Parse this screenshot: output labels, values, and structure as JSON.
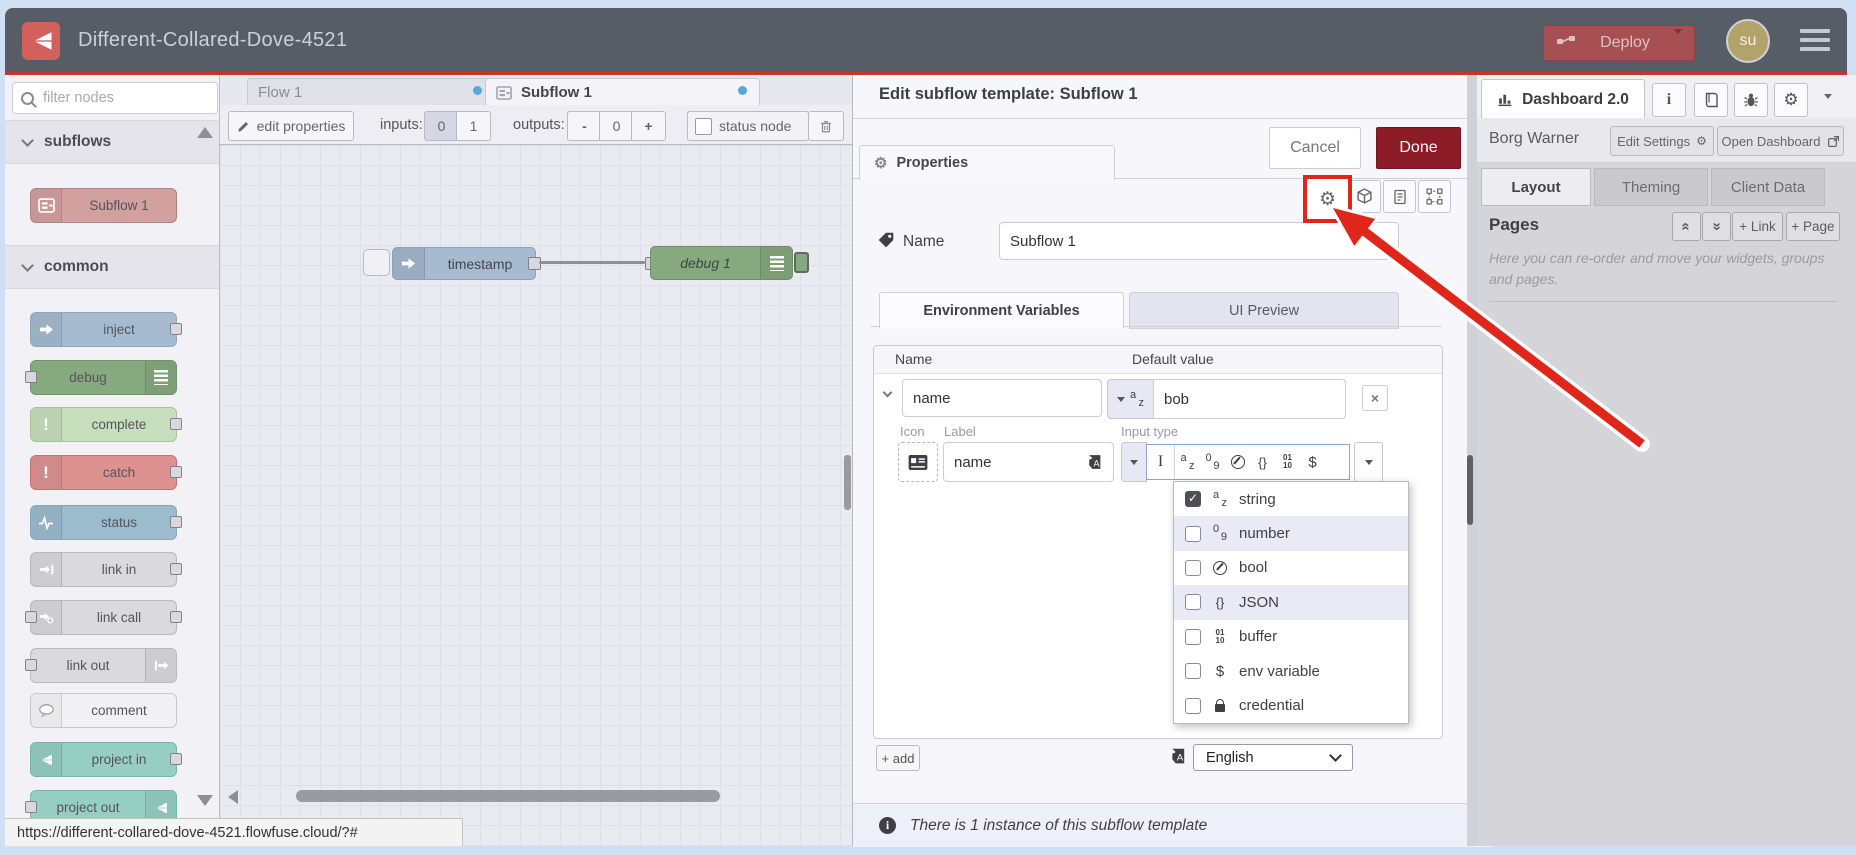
{
  "app": {
    "title": "Different-Collared-Dove-4521",
    "deploy_label": "Deploy",
    "avatar": "su",
    "url_tooltip": "https://different-collared-dove-4521.flowfuse.cloud/?#"
  },
  "palette": {
    "filter_placeholder": "filter nodes",
    "category_subflows": "subflows",
    "category_common": "common",
    "subflow_node": "Subflow 1",
    "common_nodes": [
      {
        "label": "inject"
      },
      {
        "label": "debug"
      },
      {
        "label": "complete"
      },
      {
        "label": "catch"
      },
      {
        "label": "status"
      },
      {
        "label": "link in"
      },
      {
        "label": "link call"
      },
      {
        "label": "link out"
      },
      {
        "label": "comment"
      },
      {
        "label": "project in"
      },
      {
        "label": "project out"
      }
    ]
  },
  "workspace": {
    "tabs": [
      {
        "label": "Flow 1"
      },
      {
        "label": "Subflow 1"
      }
    ],
    "toolbar": {
      "edit_properties": "edit properties",
      "inputs_label": "inputs:",
      "input_zero": "0",
      "input_one": "1",
      "outputs_label": "outputs:",
      "minus": "-",
      "output_count": "0",
      "plus": "+",
      "status_node": "status node"
    },
    "nodes": {
      "inject_label": "timestamp",
      "debug_label": "debug 1"
    }
  },
  "dialog": {
    "title": "Edit subflow template: Subflow 1",
    "cancel": "Cancel",
    "done": "Done",
    "properties_tab": "Properties",
    "name_label": "Name",
    "name_value": "Subflow 1",
    "tab_env": "Environment Variables",
    "tab_ui": "UI Preview",
    "col_name": "Name",
    "col_default": "Default value",
    "env_name": "name",
    "env_value": "bob",
    "icon_label": "Icon",
    "label_label": "Label",
    "input_type_label": "Input type",
    "env_label_value": "name",
    "types": [
      {
        "label": "string",
        "checked": true
      },
      {
        "label": "number",
        "checked": false
      },
      {
        "label": "bool",
        "checked": false
      },
      {
        "label": "JSON",
        "checked": false
      },
      {
        "label": "buffer",
        "checked": false
      },
      {
        "label": "env variable",
        "checked": false
      },
      {
        "label": "credential",
        "checked": false
      }
    ],
    "add_label": "+ add",
    "language": "English",
    "footer": "There is 1 instance of this subflow template"
  },
  "sidebar": {
    "tab": "Dashboard 2.0",
    "owner": "Borg Warner",
    "edit_settings": "Edit Settings",
    "open_dashboard": "Open Dashboard",
    "tabs": [
      {
        "label": "Layout"
      },
      {
        "label": "Theming"
      },
      {
        "label": "Client Data"
      }
    ],
    "pages_label": "Pages",
    "link_button": "+ Link",
    "page_button": "+ Page",
    "help": "Here you can re-order and move your widgets, groups and pages."
  },
  "colors": {
    "header_bg": "#565d66",
    "header_red_line": "#c5352a",
    "deploy_bg": "#a65053",
    "done_bg": "#8c1c26",
    "annotation_red": "#e0261b",
    "tab_dot_blue": "#57a7da",
    "node_subflow": "#d2a09f",
    "node_inject": "#a6bbcf",
    "node_debug": "#87a980",
    "node_complete": "#c8dfbe",
    "node_catch": "#dd9291",
    "node_status": "#9cbcce",
    "node_link": "#d9d9de",
    "node_comment": "#f1f1f3",
    "node_project": "#96cec4",
    "avatar_bg": "#b3a36b"
  },
  "icons": {
    "node-red-logo": "red rounded square with white branch glyph",
    "deploy-icon": "two nodes with wire",
    "hamburger-icon": "three bars",
    "search-icon": "magnifier",
    "pencil-icon": "pencil",
    "trash-icon": "trash can",
    "gear-icon": "gear",
    "cube-icon": "cube outline",
    "document-icon": "page with lines",
    "frame-icon": "selection frame",
    "tag-icon": "name tag",
    "drag-handle-icon": "grip bars",
    "id-card-icon": "badge card",
    "language-icon": "dark square with A",
    "info-icon": "i in circle",
    "bar-chart-icon": "bar chart",
    "book-icon": "book",
    "bug-icon": "bug",
    "external-link-icon": "box with arrow",
    "lock-icon": "padlock",
    "chevron-down-icon": "chevron down"
  }
}
